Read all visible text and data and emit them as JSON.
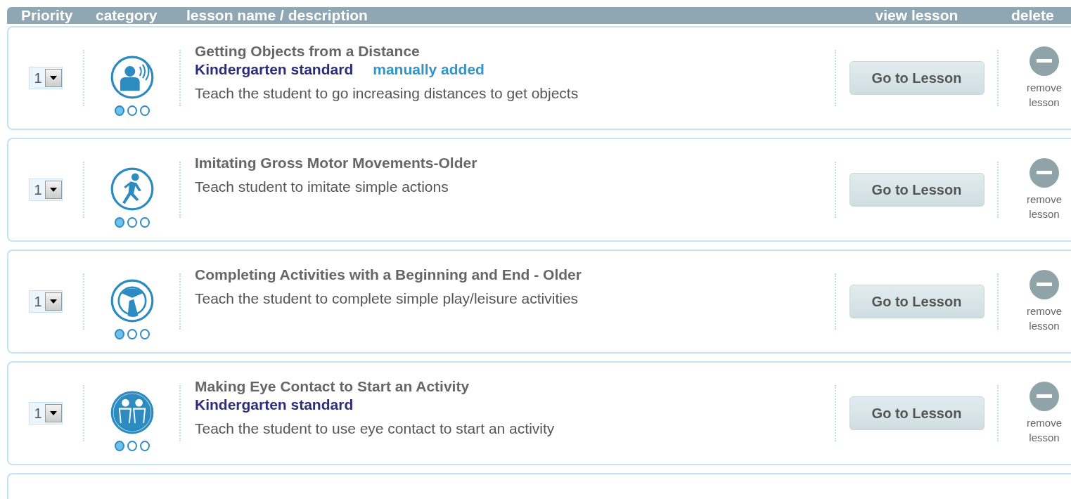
{
  "columns": [
    "Priority",
    "category",
    "lesson name / description",
    "view lesson",
    "delete"
  ],
  "lessons": [
    {
      "priority": "1",
      "kind": "listening",
      "stars": 1,
      "title": "Getting Objects from a Distance",
      "tags": [
        {
          "kind": "standard",
          "label": "Kindergarten standard"
        },
        {
          "kind": "added",
          "label": "manually added"
        }
      ],
      "description": "Teach the student to go increasing distances to get objects",
      "button": "Go to Lesson",
      "remove": "remove lesson"
    },
    {
      "priority": "1",
      "kind": "motor",
      "stars": 1,
      "title": "Imitating Gross Motor Movements-Older",
      "description": "Teach student to imitate simple actions",
      "button": "Go to Lesson",
      "remove": "remove lesson"
    },
    {
      "priority": "1",
      "kind": "play",
      "stars": 1,
      "title": "Completing Activities with a Beginning and End - Older",
      "description": "Teach the student to complete simple play/leisure activities",
      "button": "Go to Lesson",
      "remove": "remove lesson"
    },
    {
      "priority": "1",
      "kind": "social",
      "stars": 1,
      "title": "Making Eye Contact to Start an Activity",
      "tags": [
        {
          "kind": "standard",
          "label": "Kindergarten standard"
        }
      ],
      "description": "Teach the student to use eye contact to start an activity",
      "button": "Go to Lesson",
      "remove": "remove lesson"
    }
  ]
}
